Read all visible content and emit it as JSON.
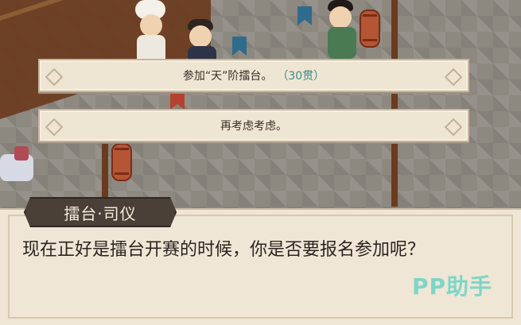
{
  "choices": [
    {
      "label": "参加“天”阶擂台。",
      "cost": "（30贯）"
    },
    {
      "label": "再考虑考虑。"
    }
  ],
  "dialog": {
    "speaker": "擂台·司仪",
    "text": "现在正好是擂台开赛的时候，你是否要报名参加呢？"
  },
  "watermark": "PP助手",
  "colors": {
    "choice_bg": "#efe5d3",
    "speaker_bg": "#4a4038",
    "cost_text": "#3f8b8d",
    "watermark": "#7ed6c7"
  }
}
